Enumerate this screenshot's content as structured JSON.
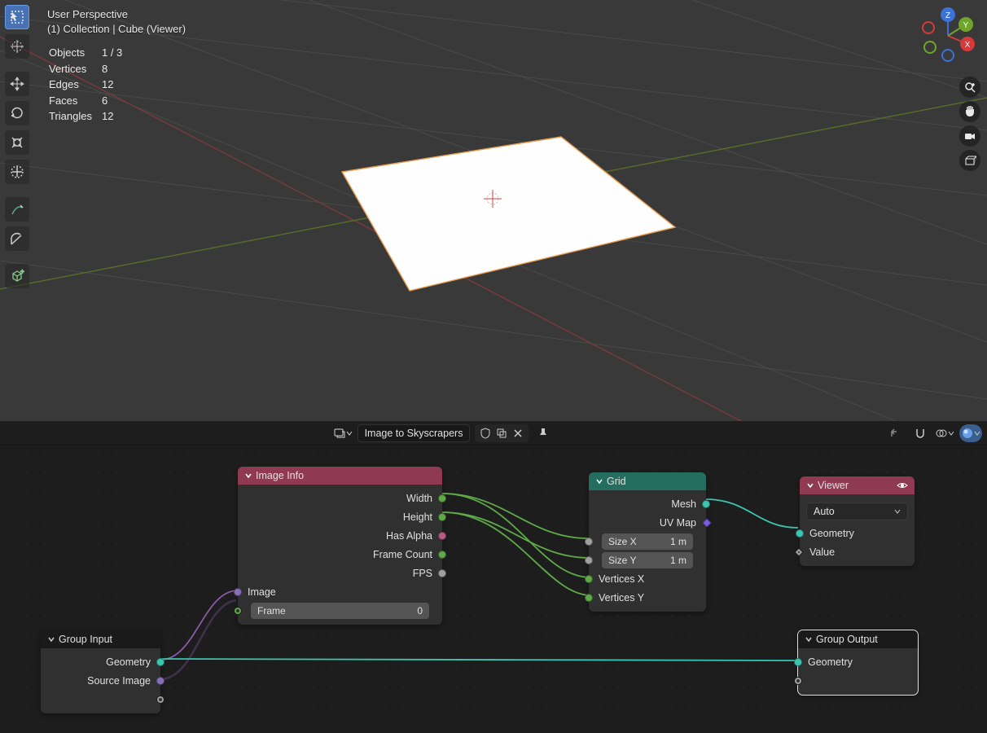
{
  "viewport": {
    "title": "User Perspective",
    "context": "(1) Collection | Cube (Viewer)",
    "stats": {
      "objects_label": "Objects",
      "objects": "1 / 3",
      "vertices_label": "Vertices",
      "vertices": "8",
      "edges_label": "Edges",
      "edges": "12",
      "faces_label": "Faces",
      "faces": "6",
      "triangles_label": "Triangles",
      "triangles": "12"
    },
    "gizmo": {
      "x": "X",
      "y": "Y",
      "z": "Z"
    }
  },
  "node_header": {
    "tree_name": "Image to Skyscrapers"
  },
  "nodes": {
    "image_info": {
      "title": "Image Info",
      "outputs": {
        "width": "Width",
        "height": "Height",
        "has_alpha": "Has Alpha",
        "frame_count": "Frame Count",
        "fps": "FPS"
      },
      "inputs": {
        "image": "Image"
      },
      "frame_field": {
        "label": "Frame",
        "value": "0"
      }
    },
    "grid": {
      "title": "Grid",
      "outputs": {
        "mesh": "Mesh",
        "uv_map": "UV Map"
      },
      "inputs": {
        "vertices_x": "Vertices X",
        "vertices_y": "Vertices Y"
      },
      "size_x": {
        "label": "Size X",
        "value": "1 m"
      },
      "size_y": {
        "label": "Size Y",
        "value": "1 m"
      }
    },
    "viewer": {
      "title": "Viewer",
      "mode": "Auto",
      "inputs": {
        "geometry": "Geometry",
        "value": "Value"
      }
    },
    "group_input": {
      "title": "Group Input",
      "outputs": {
        "geometry": "Geometry",
        "source_image": "Source Image"
      }
    },
    "group_output": {
      "title": "Group Output",
      "inputs": {
        "geometry": "Geometry"
      }
    }
  }
}
